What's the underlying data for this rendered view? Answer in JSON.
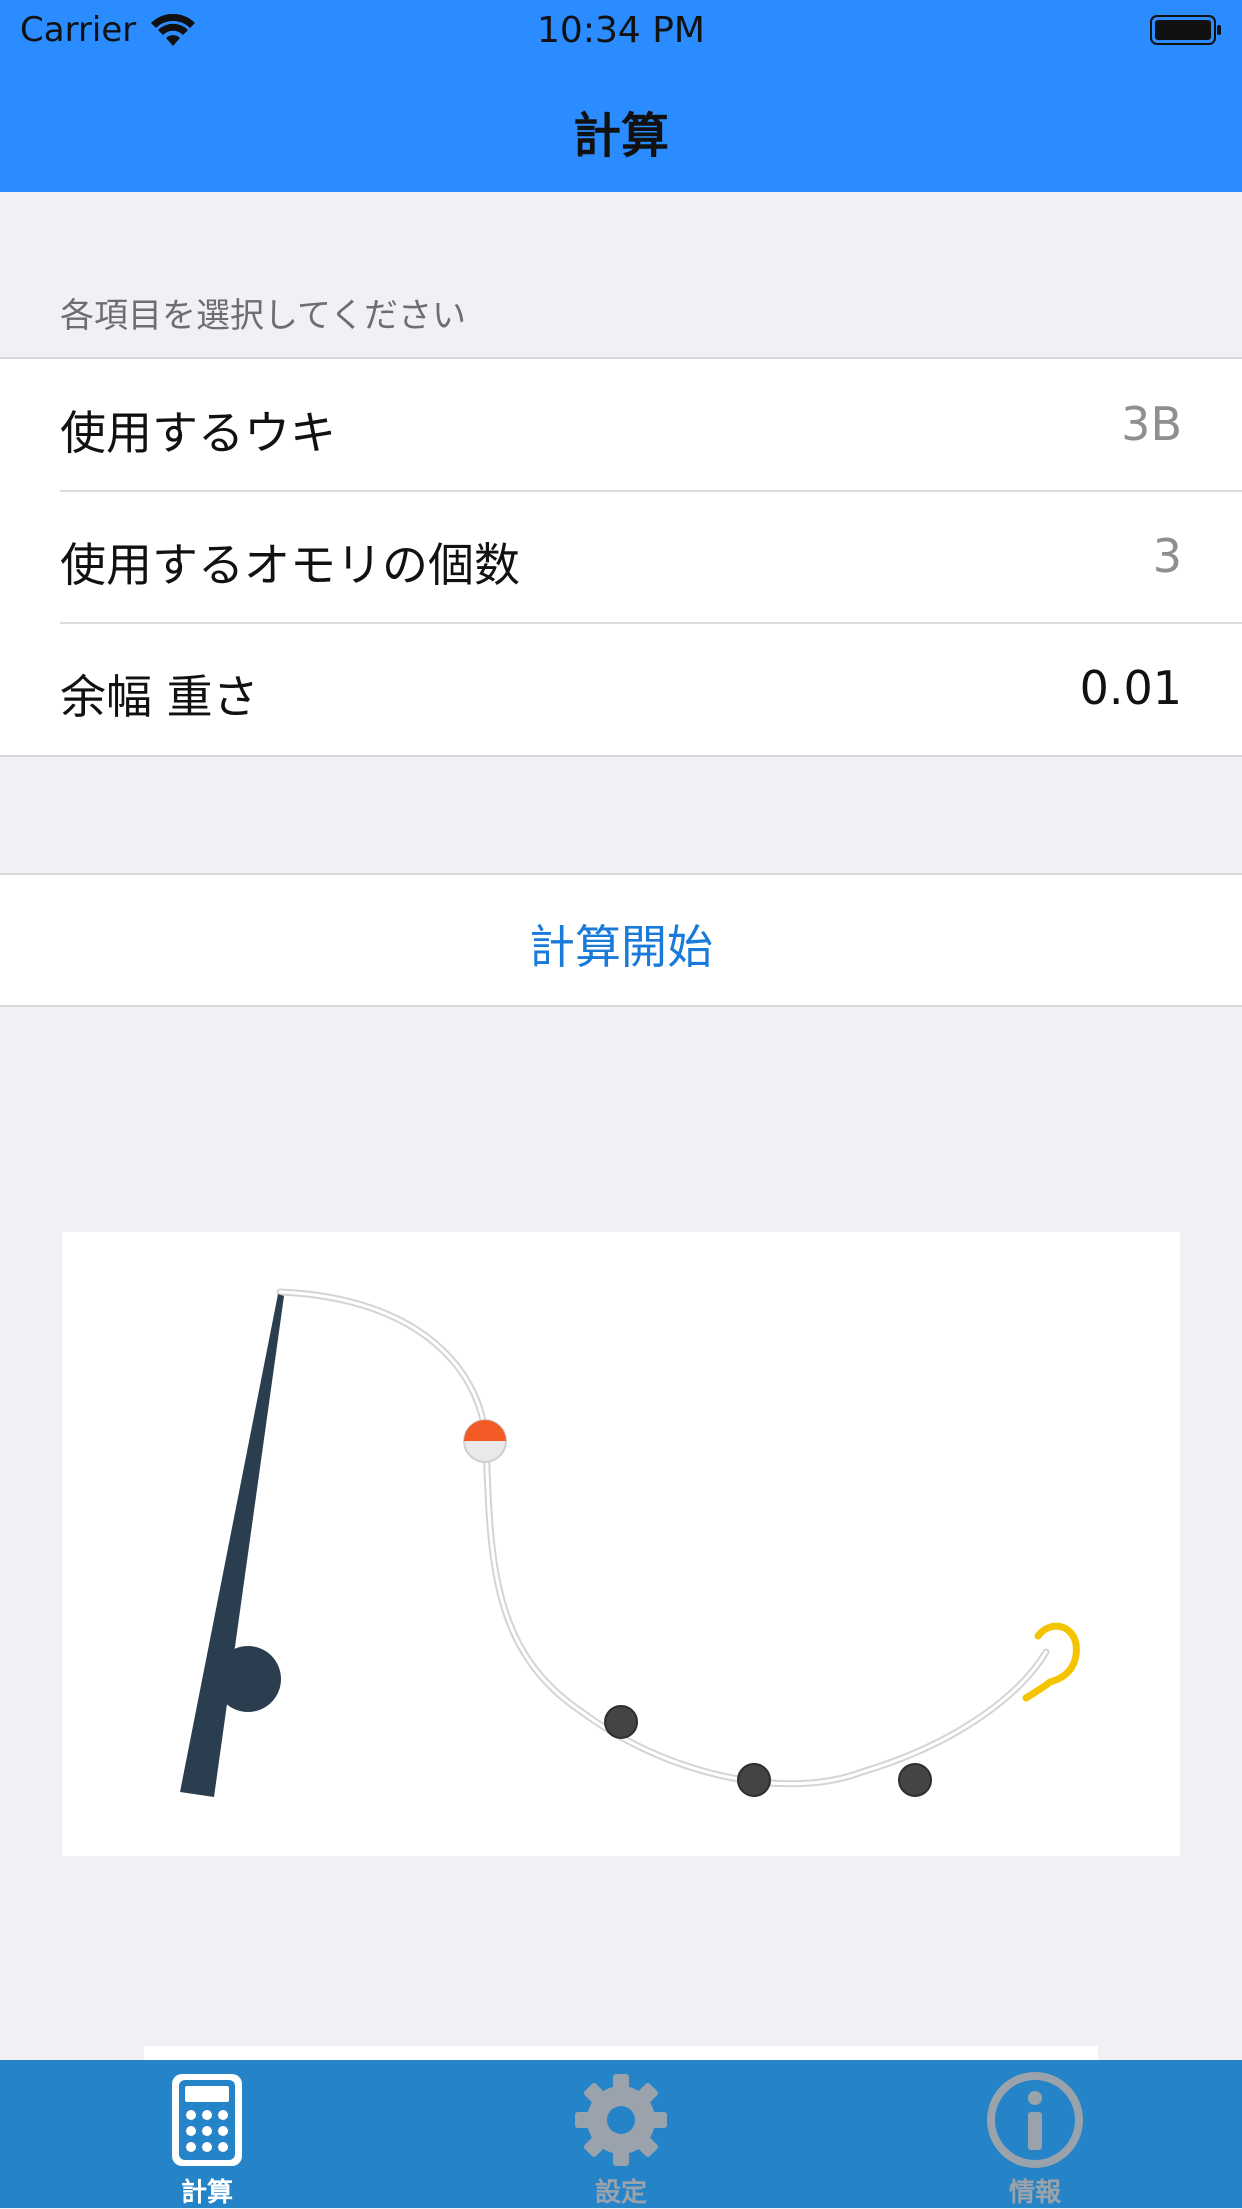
{
  "status_bar": {
    "carrier": "Carrier",
    "time": "10:34 PM"
  },
  "nav": {
    "title": "計算"
  },
  "form": {
    "section_header": "各項目を選択してください",
    "rows": [
      {
        "label": "使用するウキ",
        "value": "3B"
      },
      {
        "label": "使用するオモリの個数",
        "value": "3"
      },
      {
        "label": "余幅 重さ",
        "value": "0.01"
      }
    ]
  },
  "action": {
    "start_label": "計算開始"
  },
  "tabs": [
    {
      "label": "計算",
      "icon": "calculator-icon",
      "selected": true
    },
    {
      "label": "設定",
      "icon": "gear-icon",
      "selected": false
    },
    {
      "label": "情報",
      "icon": "info-icon",
      "selected": false
    }
  ],
  "colors": {
    "accent": "#2a8cff",
    "tabbar": "#2583c8",
    "link": "#1a7ad9",
    "rod": "#2b3e50",
    "float_top": "#f15a24",
    "hook": "#f5c400",
    "weight": "#444444",
    "tab_inactive": "#9aa3ab"
  }
}
